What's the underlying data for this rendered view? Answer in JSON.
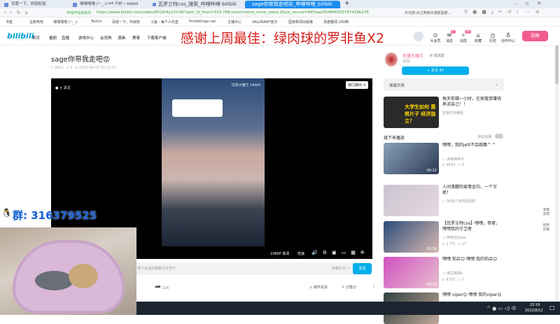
{
  "browser": {
    "tabs": [
      {
        "label": "百度一下，你就知道"
      },
      {
        "label": "嘿嘿嘿嘿 (╯-_-)╯╧╧ 干杯~-bilibili"
      },
      {
        "label": "瓦罗兰特cos_搜索_哔哩哔哩-bilibili"
      },
      {
        "label": "sage你带我走吧😡_哔哩哔哩_bilibili"
      }
    ],
    "site_label": "哔哩哔哩弹幕网",
    "url": "https://www.bilibili.com/video/BV1kt4y1V7v8/?spm_id_from=333.788.recommend_more_video.2&vd_source=997eae05d846033797429b276",
    "search": "外交部:对立陶宛交通部副部...",
    "bookmarks": [
      "书签",
      "企鹅电竞",
      "嘿嘿嘿嘿 (╯-_-)",
      "Twitch",
      "百度一下，你就知",
      "斗鱼 - 每个人的直",
      "ProSettings.net",
      "主播中心",
      "VALORANT官方",
      "国家新闻出版署",
      "百度翻译-200种"
    ]
  },
  "header": {
    "logo": "bilibili",
    "nav": [
      "首页",
      "番剧",
      "直播",
      "游戏中心",
      "会员购",
      "漫画",
      "赛事",
      "下载客户端"
    ],
    "right": [
      {
        "label": "大会员",
        "icon": "⊙"
      },
      {
        "label": "消息",
        "icon": "✉",
        "badge": "6"
      },
      {
        "label": "动态",
        "icon": "✧",
        "badge": "99"
      },
      {
        "label": "收藏",
        "icon": "⌂"
      },
      {
        "label": "历史",
        "icon": "◷"
      },
      {
        "label": "创作中心",
        "icon": "♁"
      }
    ],
    "upload": "投稿"
  },
  "overlay_text": "感谢上周最佳：绿肉球的罗非鱼X2",
  "video": {
    "title": "sage你带我走吧😡",
    "views": "9622",
    "danmaku": "4",
    "date": "2022-08-02 00:22:37",
    "follow": "+ 关注",
    "popout": "窗口弹出",
    "watermark": "坦落大魔王 bilibili",
    "quality": "1080P 高清",
    "speed": "倍速",
    "danmaku_placeholder": "发个友善的弹幕见证当下",
    "etiquette": "弹幕礼仪 >",
    "send": "发送",
    "share_count": "116",
    "report": "稿件投诉",
    "notes": "记笔记"
  },
  "uploader": {
    "name": "坦落大魔王",
    "message": "发消息",
    "desc": "溜溜",
    "follow": "+ 关注 43"
  },
  "danmaku_list": "弹幕列表",
  "ad": {
    "title": "每天剪辑一小时，在家做单赚钱养活自己！！",
    "author": "剪辑干货教程",
    "thumb_text": "大学生如何 靠剪片子 经济独立？"
  },
  "up_next": "接下来播放",
  "autoplay": "自动连播",
  "recs": [
    {
      "title": "嘿嘿，我的jett不会跳舞^ ^",
      "author": "会吸西西子",
      "views": "9833",
      "comments": "0",
      "duration": "00:12",
      "c1": "#8aa0b8",
      "c2": "#2b3a55"
    },
    {
      "title": "人间清醒的爱情金句，一个字绝！",
      "author": "90后介米情剑回阶",
      "views": "",
      "comments": "",
      "duration": "",
      "c1": "#c8c4d0",
      "c2": "#e8d8e0"
    },
    {
      "title": "【瓦罗兰特cos】嘿嘿，哥者，嘿嘿我的守卫者",
      "author": "阿咪达yeye",
      "views": "2.7万",
      "comments": "27",
      "duration": "00:56",
      "c1": "#2a4c7a",
      "c2": "#d8b8b0"
    },
    {
      "title": "嘿嘿 怕吕😊 嘿嘿 我的怕吕😊",
      "author": "敲豆麻袋z",
      "views": "8.3万",
      "comments": "7",
      "duration": "00:15",
      "c1": "#d050c0",
      "c2": "#e8c0d0"
    },
    {
      "title": "嘿嘿 viper😊 嘿嘿 我的viper😊",
      "author": "",
      "views": "",
      "comments": "",
      "duration": "",
      "c1": "#304040",
      "c2": "#c0a898"
    }
  ],
  "side_tools": [
    "新版反馈",
    "回到旧版"
  ],
  "qq_group": "群: 316379525",
  "taskbar": {
    "time": "22:16",
    "date": "2022/8/12"
  }
}
